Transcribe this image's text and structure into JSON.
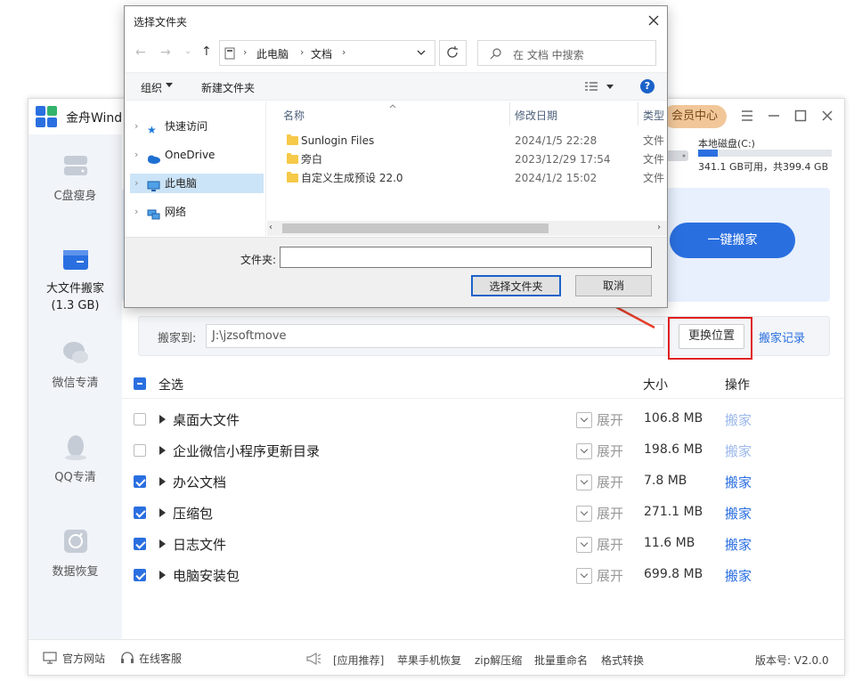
{
  "app": {
    "title": "金舟Wind",
    "member_button": "会员中心",
    "disk": {
      "name": "本地磁盘(C:)",
      "usage": "341.1 GB可用，共399.4 GB",
      "used_fraction": 0.146
    },
    "one_click_move": "一键搬家",
    "sidebar": [
      {
        "label": "C盘瘦身"
      },
      {
        "label": "大文件搬家",
        "sub": "(1.3 GB)"
      },
      {
        "label": "微信专清"
      },
      {
        "label": "QQ专清"
      },
      {
        "label": "数据恢复"
      }
    ],
    "move_to_label": "搬家到:",
    "move_to_path": "J:\\jzsoftmove",
    "change_location": "更换位置",
    "move_history": "搬家记录",
    "header": {
      "select_all": "全选",
      "size": "大小",
      "action": "操作"
    },
    "expand_label": "展开",
    "action_label": "搬家",
    "rows": [
      {
        "name": "桌面大文件",
        "size": "106.8 MB",
        "checked": false
      },
      {
        "name": "企业微信小程序更新目录",
        "size": "198.6 MB",
        "checked": false
      },
      {
        "name": "办公文档",
        "size": "7.8 MB",
        "checked": true
      },
      {
        "name": "压缩包",
        "size": "271.1 MB",
        "checked": true
      },
      {
        "name": "日志文件",
        "size": "11.6 MB",
        "checked": true
      },
      {
        "name": "电脑安装包",
        "size": "699.8 MB",
        "checked": true
      }
    ],
    "footer": {
      "website": "官方网站",
      "support": "在线客服",
      "recommend": "[应用推荐]",
      "links": [
        "苹果手机恢复",
        "zip解压缩",
        "批量重命名",
        "格式转换"
      ],
      "version": "版本号: V2.0.0"
    }
  },
  "dialog": {
    "title": "选择文件夹",
    "breadcrumb": [
      "此电脑",
      "文档"
    ],
    "search_placeholder": "在 文档 中搜索",
    "organize": "组织",
    "new_folder": "新建文件夹",
    "nav": [
      "快速访问",
      "OneDrive",
      "此电脑",
      "网络"
    ],
    "columns": {
      "name": "名称",
      "modified": "修改日期",
      "type": "类型"
    },
    "files": [
      {
        "name": "Sunlogin Files",
        "date": "2024/1/5 22:28",
        "type": "文件"
      },
      {
        "name": "旁白",
        "date": "2023/12/29 17:54",
        "type": "文件"
      },
      {
        "name": "自定义生成预设 22.0",
        "date": "2024/1/2 15:02",
        "type": "文件"
      }
    ],
    "folder_label": "文件夹:",
    "folder_value": "",
    "select_button": "选择文件夹",
    "cancel_button": "取消"
  },
  "colors": {
    "accent": "#2a6fe0",
    "member_bg": "#f1c79a",
    "highlight": "#e02020",
    "arrow": "#e8402a"
  }
}
